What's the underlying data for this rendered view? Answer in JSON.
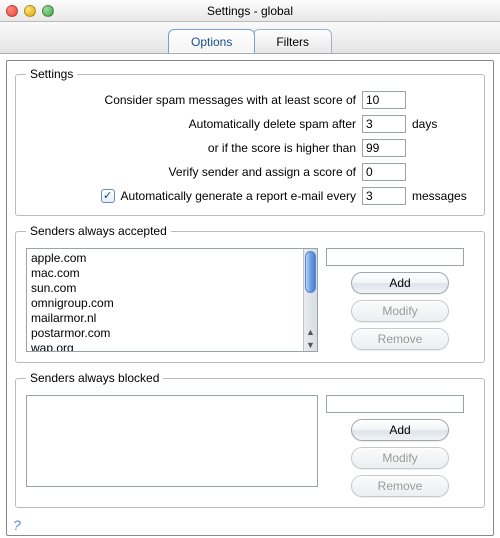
{
  "window": {
    "title": "Settings - global"
  },
  "tabs": {
    "options": "Options",
    "filters": "Filters"
  },
  "settings": {
    "legend": "Settings",
    "row1_label": "Consider spam messages with at least score of",
    "row1_value": "10",
    "row2_label": "Automatically delete spam after",
    "row2_value": "3",
    "row2_suffix": "days",
    "row3_label": "or if the score is higher than",
    "row3_value": "99",
    "row4_label": "Verify sender and assign a score of",
    "row4_value": "0",
    "row5_checked": true,
    "row5_label": "Automatically generate a report e-mail every",
    "row5_value": "3",
    "row5_suffix": "messages"
  },
  "accepted": {
    "legend": "Senders always accepted",
    "items": [
      "apple.com",
      "mac.com",
      "sun.com",
      "omnigroup.com",
      "mailarmor.nl",
      "postarmor.com",
      "wap.org"
    ],
    "input": "",
    "add": "Add",
    "modify": "Modify",
    "remove": "Remove"
  },
  "blocked": {
    "legend": "Senders always blocked",
    "items": [],
    "input": "",
    "add": "Add",
    "modify": "Modify",
    "remove": "Remove"
  },
  "help": "?"
}
